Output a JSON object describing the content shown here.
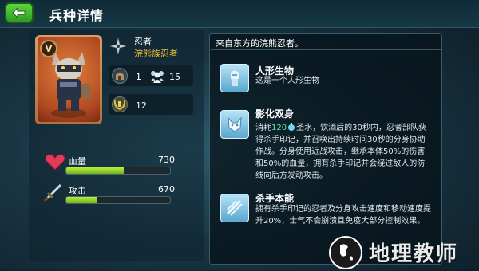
{
  "header": {
    "title": "兵种详情",
    "back_icon": "back-arrow-icon"
  },
  "unit": {
    "level_badge": "V",
    "name": "忍者",
    "subname": "浣熊族忍者",
    "cost": "1",
    "population": "15",
    "count": "12"
  },
  "stats": {
    "hp": {
      "label": "血量",
      "value": "730",
      "fraction": 0.55
    },
    "attack": {
      "label": "攻击",
      "value": "670",
      "fraction": 0.3
    }
  },
  "description": "来自东方的浣熊忍者。",
  "skills": [
    {
      "title": "人形生物",
      "text": "这是一个人形生物",
      "icon": "humanoid-knight-icon"
    },
    {
      "title": "影化双身",
      "text_before": "消耗",
      "highlight": "120",
      "text_after": "圣水，饮酒后的30秒内，忍者部队获得杀手印记，并召唤出持续时间30秒的分身协助作战。分身使用近战攻击，继承本体50%的伤害和50%的血量，拥有杀手印记并会绕过敌人的防线向后方发动攻击。",
      "icon": "shadow-clone-fox-icon"
    },
    {
      "title": "杀手本能",
      "text": "拥有杀手印记的忍者及分身攻击速度和移动速度提升20%，士气不会崩溃且免疫大部分控制效果。",
      "icon": "slash-claw-icon"
    }
  ],
  "watermark": {
    "text": "地理教师"
  },
  "colors": {
    "accent_green": "#5bd63f",
    "gold": "#f2c12e",
    "bar_green": "#8fd12a",
    "highlight": "#5ee7a6"
  }
}
